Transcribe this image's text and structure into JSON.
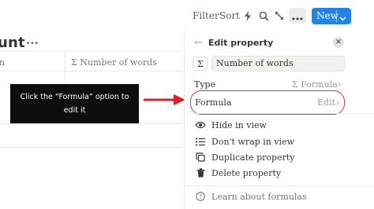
{
  "toolbar": {
    "filter_label": "Filter",
    "sort_label": "Sort",
    "lightning_icon": "lightning-icon",
    "search_icon": "search-icon",
    "expand_icon": "expand-icon",
    "more_icon": "more-icon",
    "new_label": "New",
    "new_chevron_icon": "chevron-down-icon",
    "accent_color": "#2383e2"
  },
  "table": {
    "title": "unt",
    "columns": [
      {
        "label": "n"
      },
      {
        "label": "Number of words",
        "icon": "sigma-icon"
      }
    ]
  },
  "callout": {
    "text": "Click the “Formula” option to edit it",
    "arrow_color": "#d9232a",
    "highlight_color": "#cf3a3a"
  },
  "panel": {
    "title": "Edit property",
    "close_icon": "close-icon",
    "property_icon": "Σ",
    "property_name": "Number of words",
    "type_label": "Type",
    "type_value": "Σ Formula",
    "formula_label": "Formula",
    "edit_label": "Edit",
    "actions": [
      {
        "label": "Hide in view",
        "icon": "eye-icon"
      },
      {
        "label": "Don't wrap in view",
        "icon": "list-icon"
      },
      {
        "label": "Duplicate property",
        "icon": "duplicate-icon"
      },
      {
        "label": "Delete property",
        "icon": "trash-icon"
      }
    ],
    "learn_label": "Learn about formulas",
    "learn_icon": "help-icon"
  }
}
